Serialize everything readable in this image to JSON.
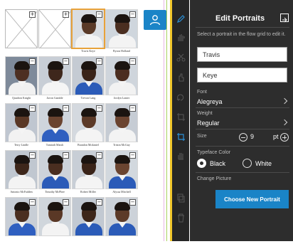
{
  "grid": {
    "rows": [
      [
        {
          "name": "",
          "empty": true
        },
        {
          "name": "",
          "empty": true
        },
        {
          "name": "Travis Keye",
          "empty": false,
          "selected": true,
          "skin": "#5a3a28",
          "bg": "#d9dde2",
          "shirt": "#f3f3f3"
        },
        {
          "name": "Byron Holland",
          "empty": false,
          "skin": "#4a2e20",
          "bg": "#cfd6dd",
          "shirt": "#f3f3f3"
        }
      ],
      [
        {
          "name": "Quadron Knight",
          "empty": false,
          "skin": "#4d2f22",
          "bg": "#7e8a9a",
          "shirt": "#f1f1f1"
        },
        {
          "name": "Javon Gamble",
          "empty": false,
          "skin": "#3e271c",
          "bg": "#c8ced6",
          "shirt": "#f5f5f5"
        },
        {
          "name": "Trevon Lang",
          "empty": false,
          "skin": "#3a2419",
          "bg": "#c5cbd3",
          "shirt": "#2b5bb8"
        },
        {
          "name": "Jordyn Lanier",
          "empty": false,
          "skin": "#4b2d20",
          "bg": "#cfd5dc",
          "shirt": "#f2f2f2"
        }
      ],
      [
        {
          "name": "Terry Lindle",
          "empty": false,
          "skin": "#5a3826",
          "bg": "#bfc6d0",
          "shirt": "#f2f2f2"
        },
        {
          "name": "Tamirah Marsh",
          "empty": false,
          "skin": "#6a4430",
          "bg": "#cfd5dc",
          "shirt": "#2f5fc0"
        },
        {
          "name": "Brandon Mcdaniel",
          "empty": false,
          "skin": "#5c3a28",
          "bg": "#d4d9df",
          "shirt": "#f4f4f4"
        },
        {
          "name": "Tristin McGuy",
          "empty": false,
          "skin": "#6b4430",
          "bg": "#c6ccd4",
          "shirt": "#f3f3f3"
        }
      ],
      [
        {
          "name": "Antonio McFadden",
          "empty": false,
          "skin": "#3d261a",
          "bg": "#c0c7d0",
          "shirt": "#f3f3f3"
        },
        {
          "name": "Timothy McPhee",
          "empty": false,
          "skin": "#4a2e20",
          "bg": "#cdd3da",
          "shirt": "#2b5bb8"
        },
        {
          "name": "Robert Miller",
          "empty": false,
          "skin": "#3a2419",
          "bg": "#c8ced6",
          "shirt": "#f4f4f4"
        },
        {
          "name": "Alyssa Mitchell",
          "empty": false,
          "skin": "#6a4430",
          "bg": "#d2d8de",
          "shirt": "#2b5bb8"
        }
      ],
      [
        {
          "name": "",
          "empty": false,
          "skin": "#4a2e20",
          "bg": "#c8ced6",
          "shirt": "#2f5fc0"
        },
        {
          "name": "",
          "empty": false,
          "skin": "#5a3826",
          "bg": "#d0d6dc",
          "shirt": "#f3f3f3"
        },
        {
          "name": "",
          "empty": false,
          "skin": "#3d261a",
          "bg": "#c2c9d2",
          "shirt": "#2b5bb8"
        },
        {
          "name": "",
          "empty": false,
          "skin": "#5c3a28",
          "bg": "#ccd2d9",
          "shirt": "#2b5bb8"
        }
      ]
    ],
    "selected_border_color": "#e8a23a"
  },
  "panel": {
    "title": "Edit Portraits",
    "hint": "Select a portrait in the flow grid to edit it.",
    "first_name": "Travis",
    "last_name": "Keye",
    "font_label": "Font",
    "font_value": "Alegreya",
    "weight_label": "Weight",
    "weight_value": "Regular",
    "size_label": "Size",
    "size_value": "9",
    "size_unit": "pt",
    "typeface_color_label": "Typeface Color",
    "color_black": "Black",
    "color_white": "White",
    "color_selected": "Black",
    "change_picture_label": "Change Picture",
    "choose_button": "Choose New Portrait"
  },
  "colors": {
    "accent": "#1a84c7",
    "panel_bg": "#2d2d2d",
    "rail_bg": "#262626",
    "selection": "#e8a23a"
  },
  "rail_icons": [
    "pencil-icon",
    "hand-icon",
    "scissors-icon",
    "pointer-icon",
    "rotate-icon",
    "crop-icon",
    "portrait-crop-icon",
    "hand-grab-icon",
    "copy-icon",
    "trash-icon"
  ]
}
